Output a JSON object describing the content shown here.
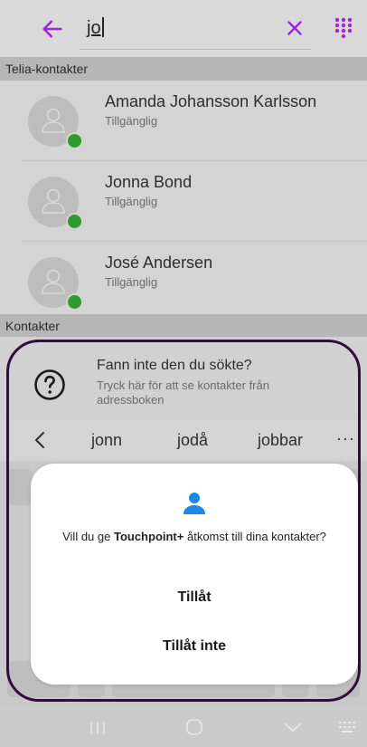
{
  "search": {
    "query_underlined": "jo",
    "clear_icon": "close-icon",
    "back_icon": "arrow-left-icon",
    "dialpad_icon": "dialpad-icon"
  },
  "sections": {
    "telia": "Telia-kontakter",
    "contacts": "Kontakter"
  },
  "telia_contacts": [
    {
      "name": "Amanda Johansson Karlsson",
      "status": "Tillgänglig"
    },
    {
      "name": "Jonna Bond",
      "status": "Tillgänglig"
    },
    {
      "name": "José Andersen",
      "status": "Tillgänglig"
    }
  ],
  "not_found": {
    "title": "Fann inte den du sökte?",
    "subtitle": "Tryck här för att se kontakter från adressboken"
  },
  "suggestions": [
    "jonn",
    "jodå",
    "jobbar"
  ],
  "suggestions_more": "···",
  "dialog": {
    "message_prefix": "Vill du ge ",
    "app_name": "Touchpoint+",
    "message_suffix": " åtkomst till dina kontakter?",
    "allow": "Tillåt",
    "deny": "Tillåt inte"
  },
  "colors": {
    "accent": "#9b27d6",
    "presence": "#2f9b2f",
    "dialog_icon": "#1e88e5",
    "highlight_border": "#2d0f38"
  }
}
